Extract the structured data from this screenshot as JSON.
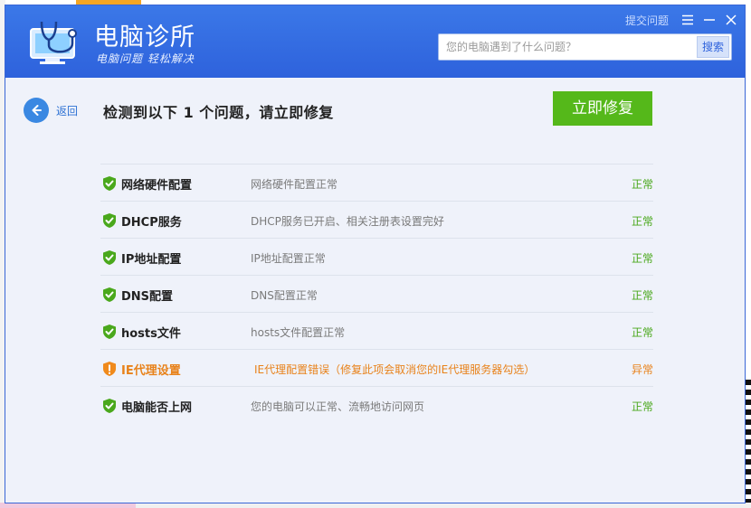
{
  "app": {
    "title": "电脑诊所",
    "slogan": "电脑问题 轻松解决",
    "help_link": "提交问题"
  },
  "search": {
    "placeholder": "您的电脑遇到了什么问题？",
    "value": "",
    "button_label": "搜索"
  },
  "nav": {
    "back_label": "返回"
  },
  "result": {
    "title": "检测到以下 1 个问题，请立即修复",
    "fix_button_label": "立即修复"
  },
  "items": [
    {
      "name": "网络硬件配置",
      "desc": "网络硬件配置正常",
      "status": "正常",
      "state": "ok"
    },
    {
      "name": "DHCP服务",
      "desc": "DHCP服务已开启、相关注册表设置完好",
      "status": "正常",
      "state": "ok"
    },
    {
      "name": "IP地址配置",
      "desc": "IP地址配置正常",
      "status": "正常",
      "state": "ok"
    },
    {
      "name": "DNS配置",
      "desc": "DNS配置正常",
      "status": "正常",
      "state": "ok"
    },
    {
      "name": "hosts文件",
      "desc": "hosts文件配置正常",
      "status": "正常",
      "state": "ok"
    },
    {
      "name": "IE代理设置",
      "desc": "IE代理配置错误（修复此项会取消您的IE代理服务器勾选）",
      "status": "异常",
      "state": "error"
    },
    {
      "name": "电脑能否上网",
      "desc": "您的电脑可以正常、流畅地访问网页",
      "status": "正常",
      "state": "ok"
    }
  ],
  "icons": {
    "ok": "shield-check-icon",
    "error": "shield-exclamation-icon"
  },
  "colors": {
    "header_blue": "#2e62dc",
    "fix_green": "#55b81a",
    "ok_green": "#4aa81c",
    "error_orange": "#e8821a"
  }
}
